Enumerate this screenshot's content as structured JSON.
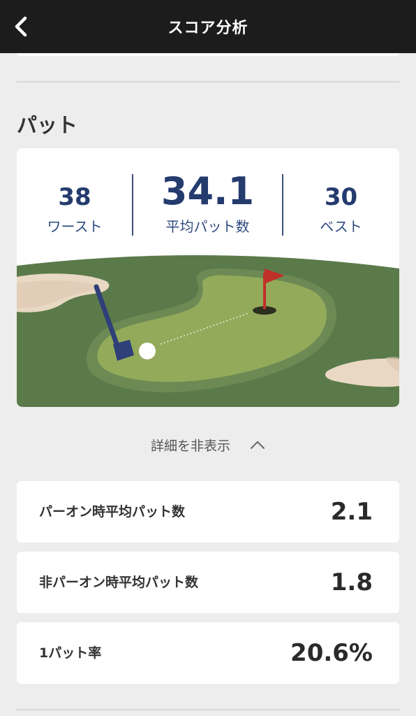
{
  "header": {
    "title": "スコア分析",
    "back_icon": "chevron-left-icon"
  },
  "section": {
    "title": "パット"
  },
  "putt_stats": {
    "worst": {
      "value": "38",
      "label": "ワースト"
    },
    "average": {
      "value": "34.1",
      "label": "平均パット数"
    },
    "best": {
      "value": "30",
      "label": "ベスト"
    }
  },
  "details_toggle": {
    "label": "詳細を非表示",
    "icon": "chevron-up-icon"
  },
  "detail_rows": [
    {
      "label": "パーオン時平均パット数",
      "value": "2.1"
    },
    {
      "label": "非パーオン時平均パット数",
      "value": "1.8"
    },
    {
      "label": "1パット率",
      "value": "20.6%"
    }
  ],
  "colors": {
    "header_bg": "#1c1c1c",
    "page_bg": "#ededed",
    "stat_text": "#243b6e",
    "fairway": "#5b7a4a",
    "green": "#93aa5a",
    "fringe": "#6d8a55",
    "sand": "#e8d8c4",
    "flag": "#c0302a",
    "putter": "#2f3f78"
  }
}
